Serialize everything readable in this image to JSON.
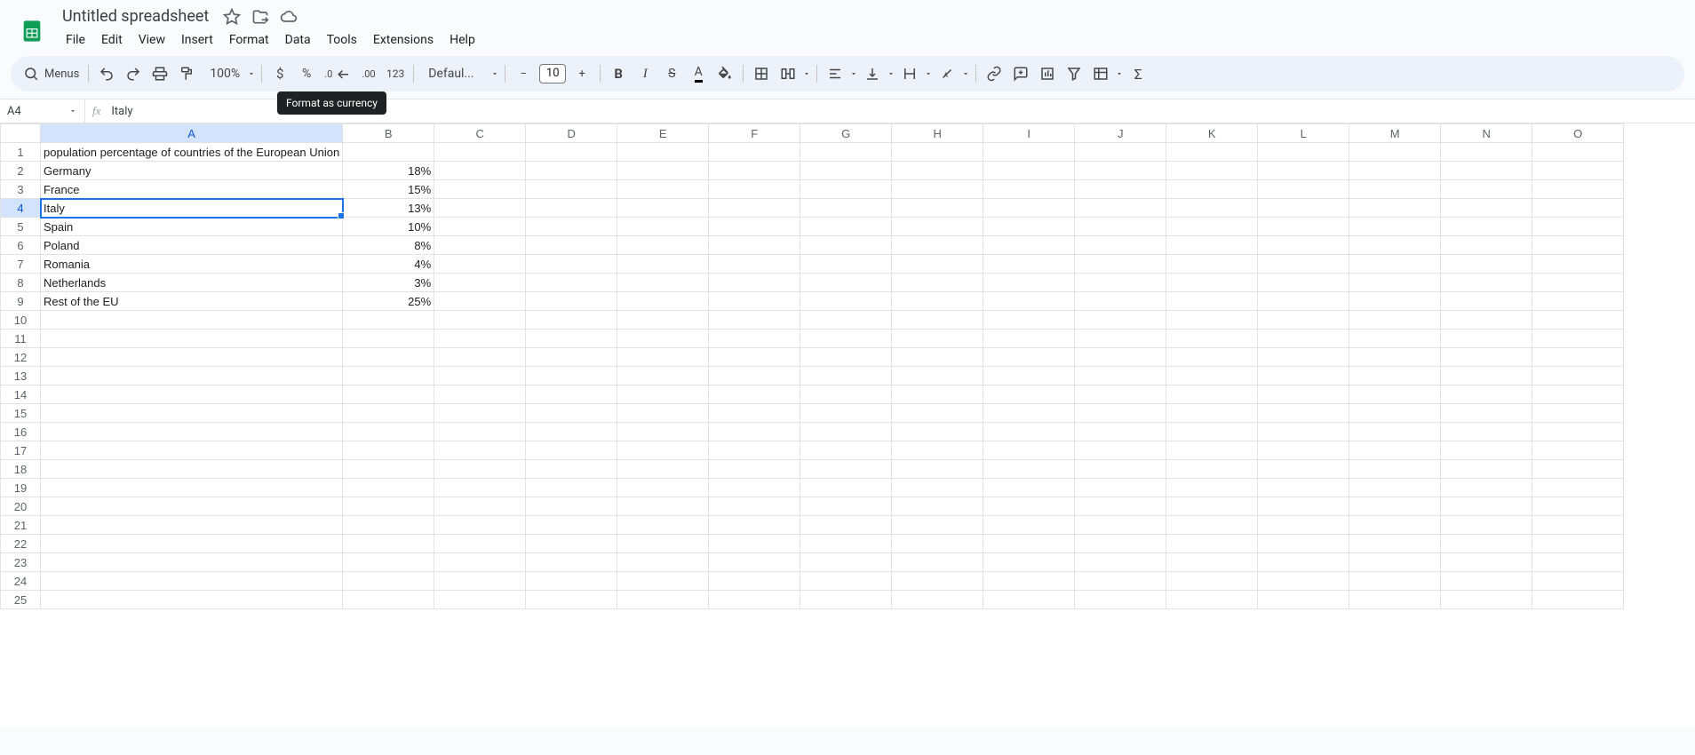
{
  "header": {
    "doc_title": "Untitled spreadsheet",
    "menus": [
      "File",
      "Edit",
      "View",
      "Insert",
      "Format",
      "Data",
      "Tools",
      "Extensions",
      "Help"
    ]
  },
  "toolbar": {
    "menus_label": "Menus",
    "zoom": "100%",
    "font": "Defaul...",
    "font_size": "10",
    "tooltip": "Format as currency"
  },
  "name_box": "A4",
  "formula_value": "Italy",
  "selected_cell": {
    "row": 4,
    "col": 1
  },
  "columns": [
    "A",
    "B",
    "C",
    "D",
    "E",
    "F",
    "G",
    "H",
    "I",
    "J",
    "K",
    "L",
    "M",
    "N",
    "O"
  ],
  "row_count": 25,
  "cells": {
    "A1": "population percentage of countries of the European Union",
    "A2": "Germany",
    "B2": "18%",
    "A3": "France",
    "B3": "15%",
    "A4": "Italy",
    "B4": "13%",
    "A5": "Spain",
    "B5": "10%",
    "A6": "Poland",
    "B6": "8%",
    "A7": "Romania",
    "B7": "4%",
    "A8": "Netherlands",
    "B8": "3%",
    "A9": "Rest of the EU",
    "B9": "25%"
  },
  "chart_data": {
    "type": "table",
    "title": "population percentage of countries of the European Union",
    "categories": [
      "Germany",
      "France",
      "Italy",
      "Spain",
      "Poland",
      "Romania",
      "Netherlands",
      "Rest of the EU"
    ],
    "values": [
      18,
      15,
      13,
      10,
      8,
      4,
      3,
      25
    ],
    "unit": "%"
  }
}
